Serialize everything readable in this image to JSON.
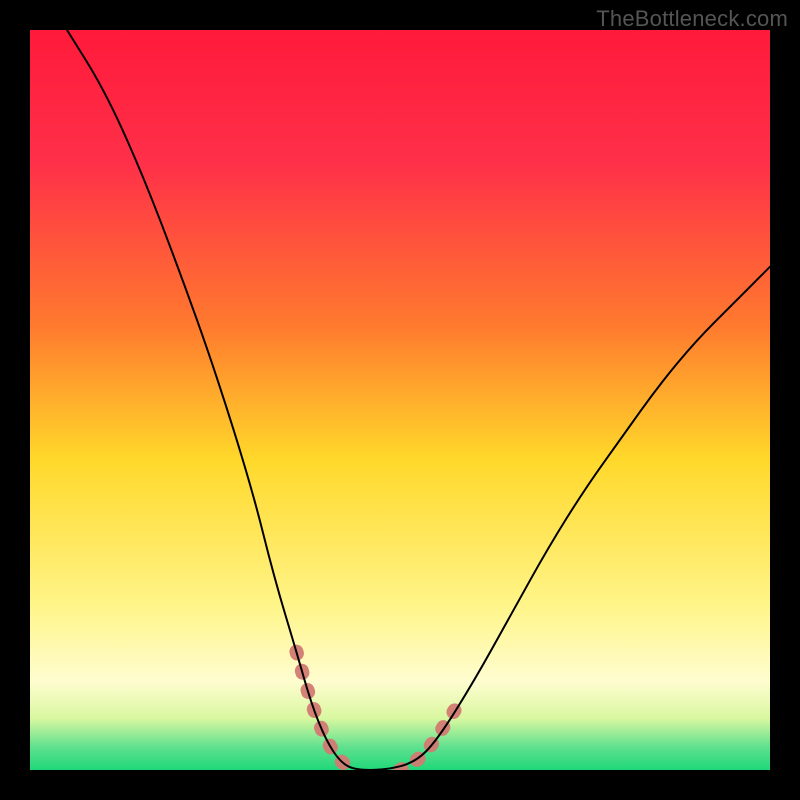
{
  "watermark": "TheBottleneck.com",
  "chart_data": {
    "type": "line",
    "title": "",
    "xlabel": "",
    "ylabel": "",
    "xlim": [
      0,
      100
    ],
    "ylim": [
      0,
      100
    ],
    "grid": false,
    "legend": false,
    "background": {
      "type": "vertical-gradient",
      "stops": [
        {
          "pos": 0.0,
          "color": "#ff1a3a"
        },
        {
          "pos": 0.18,
          "color": "#ff3049"
        },
        {
          "pos": 0.4,
          "color": "#ff7a2e"
        },
        {
          "pos": 0.58,
          "color": "#ffd82a"
        },
        {
          "pos": 0.78,
          "color": "#fff58a"
        },
        {
          "pos": 0.88,
          "color": "#fffdd0"
        },
        {
          "pos": 0.93,
          "color": "#d9f7a0"
        },
        {
          "pos": 0.97,
          "color": "#5de08e"
        },
        {
          "pos": 1.0,
          "color": "#1fd879"
        }
      ]
    },
    "series": [
      {
        "name": "bottleneck-curve",
        "color": "#000000",
        "stroke_width": 2,
        "x": [
          5,
          10,
          15,
          20,
          25,
          30,
          33,
          36,
          38,
          40,
          42,
          44,
          48,
          52,
          55,
          60,
          65,
          70,
          75,
          80,
          85,
          90,
          95,
          100
        ],
        "y": [
          100,
          92,
          81,
          68,
          54,
          38,
          26,
          16,
          9,
          4,
          1,
          0,
          0,
          1,
          4,
          12,
          21,
          30,
          38,
          45,
          52,
          58,
          63,
          68
        ]
      }
    ],
    "highlight_segments": [
      {
        "name": "valley-left-glow",
        "color": "#d27a72",
        "stroke_width": 14,
        "x": [
          36,
          38,
          40,
          42,
          44
        ],
        "y": [
          16,
          9,
          4,
          1,
          0
        ]
      },
      {
        "name": "valley-right-glow",
        "color": "#d27a72",
        "stroke_width": 14,
        "x": [
          50,
          52,
          54,
          56,
          58
        ],
        "y": [
          0,
          1,
          3,
          6,
          9
        ]
      }
    ]
  }
}
